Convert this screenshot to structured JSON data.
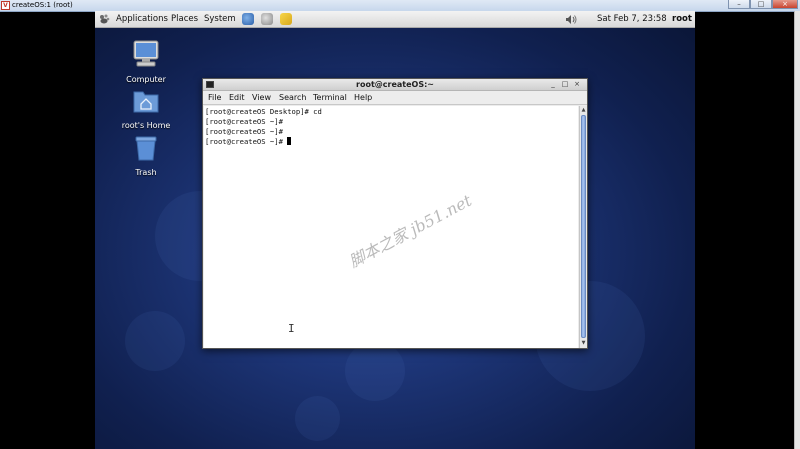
{
  "viewer": {
    "title": "createOS:1 (root)",
    "icon_letter": "V",
    "controls": [
      "minimize-icon",
      "maximize-icon",
      "close-icon"
    ]
  },
  "panel": {
    "menus": [
      "Applications",
      "Places",
      "System"
    ],
    "launchers": [
      "browser-icon",
      "mail-icon",
      "notes-icon"
    ],
    "volume_icon": "speaker-icon",
    "clock": "Sat Feb  7, 23:58",
    "user": "root"
  },
  "desktop_icons": [
    {
      "label": "Computer",
      "icon": "computer-icon"
    },
    {
      "label": "root's Home",
      "icon": "home-folder-icon"
    },
    {
      "label": "Trash",
      "icon": "trash-icon"
    }
  ],
  "terminal": {
    "title": "root@createOS:~",
    "window_buttons": {
      "minimize": "_",
      "maximize": "□",
      "close": "×"
    },
    "menu": [
      "File",
      "Edit",
      "View",
      "Search",
      "Terminal",
      "Help"
    ],
    "lines": [
      "[root@createOS Desktop]# cd",
      "[root@createOS ~]#",
      "[root@createOS ~]#",
      "[root@createOS ~]# "
    ]
  },
  "watermark": "脚本之家 jb51.net",
  "colors": {
    "desktop_blue": "#1d3577",
    "scroll_thumb": "#8fb1e6"
  }
}
